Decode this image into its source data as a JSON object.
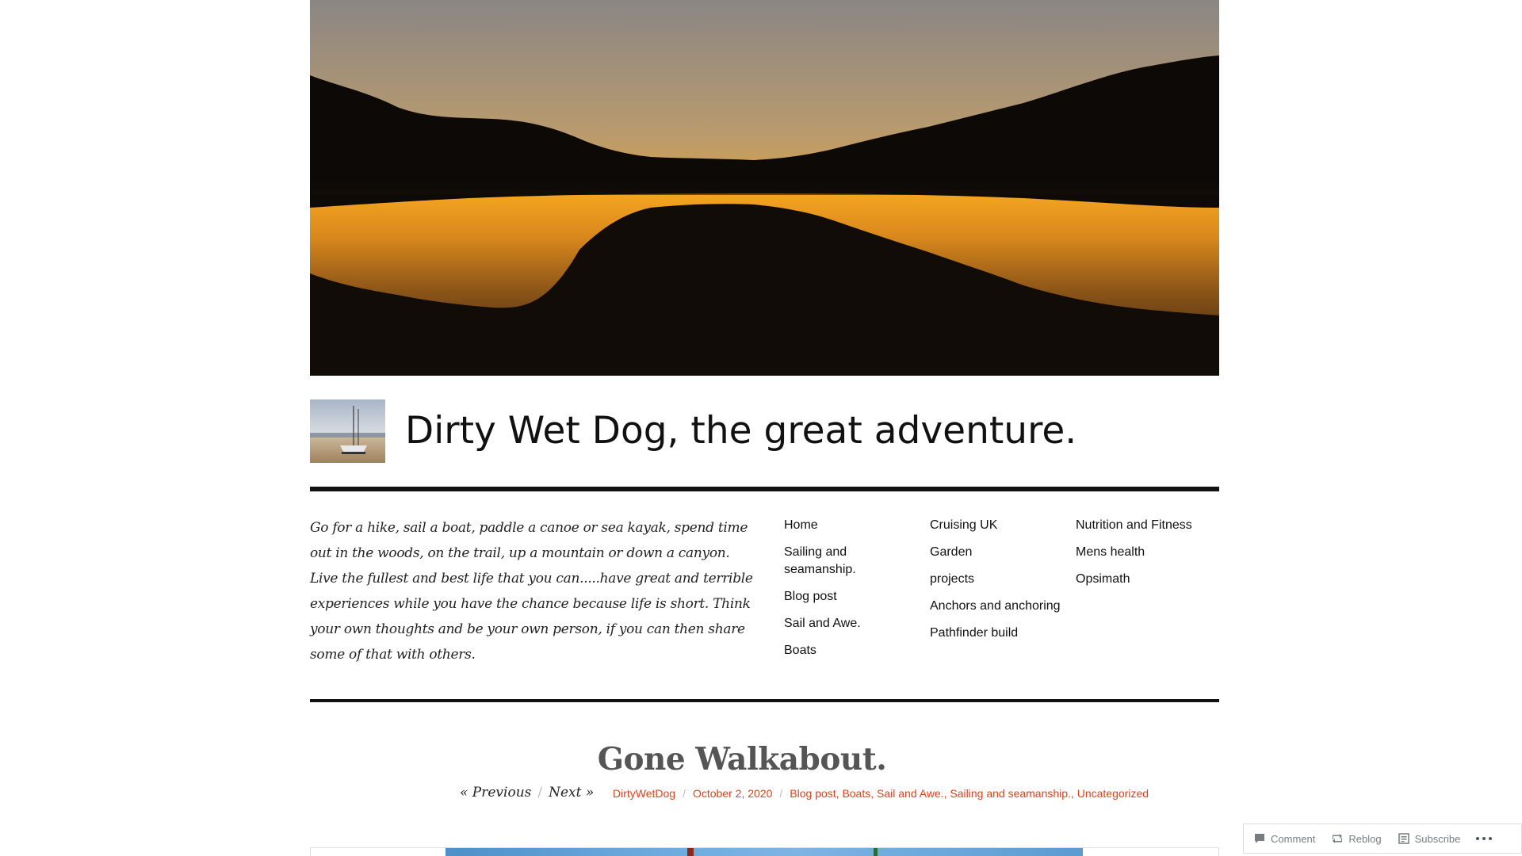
{
  "site": {
    "title": "Dirty Wet Dog, the great adventure.",
    "tagline": "Go for a hike, sail a boat, paddle a canoe or sea kayak, spend time out in the woods, on the trail, up a mountain or down a canyon. Live the fullest and best life that you can.....have great and terrible experiences while you have the chance because life is short. Think your own thoughts and be your own person, if you can then share some of that with others."
  },
  "menu": {
    "col1": [
      "Home",
      "Sailing and seamanship.",
      "Blog post",
      "Sail and Awe.",
      "Boats"
    ],
    "col2": [
      "Cruising UK",
      "Garden",
      "projects",
      "Anchors and anchoring",
      "Pathfinder build"
    ],
    "col3": [
      "Nutrition and Fitness",
      "Mens health",
      "Opsimath"
    ]
  },
  "post": {
    "title": "Gone Walkabout.",
    "nav": {
      "previous": "« Previous",
      "next": "Next »",
      "separator": "/"
    },
    "meta": {
      "author": "DirtyWetDog",
      "date": "October 2, 2020",
      "categories": [
        "Blog post",
        "Boats",
        "Sail and Awe.",
        "Sailing and seamanship.",
        "Uncategorized"
      ],
      "separator": "/"
    }
  },
  "action_bar": {
    "comment": "Comment",
    "reblog": "Reblog",
    "subscribe": "Subscribe"
  },
  "colors": {
    "accent": "#e0401d",
    "text": "#111111",
    "post_title": "#555555"
  }
}
